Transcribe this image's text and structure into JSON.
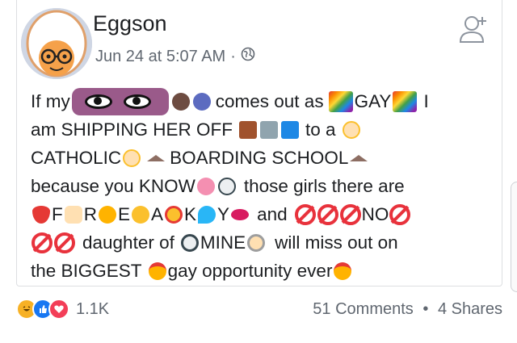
{
  "post": {
    "author": "Eggson",
    "timestamp": "Jun 24 at 5:07 AM",
    "separator": "·",
    "privacy_icon": "globe-icon",
    "lines": [
      {
        "t1": "If my",
        "t2": "comes out as",
        "t3": "GAY",
        "t4": "I"
      },
      {
        "t1": "am SHIPPING HER OFF",
        "t2": "to a"
      },
      {
        "t1": "CATHOLIC",
        "t2": "BOARDING SCHOOL"
      },
      {
        "t1": "because you KNOW",
        "t2": "those girls there are"
      },
      {
        "t1": "F",
        "t2": "R",
        "t3": "E",
        "t4": "A",
        "t5": "K",
        "t6": "Y",
        "t7": "and",
        "t8": "NO"
      },
      {
        "t1": "daughter of",
        "t2": "MINE",
        "t3": "will miss out on"
      },
      {
        "t1": "the BIGGEST",
        "t2": "gay opportunity ever"
      }
    ]
  },
  "footer": {
    "reaction_count": "1.1K",
    "comments": "51 Comments",
    "separator": "•",
    "shares": "4 Shares"
  },
  "colors": {
    "like_blue": "#1877f2",
    "love_red": "#f33e58",
    "haha_yellow": "#f7b125",
    "block_red": "#e8323c",
    "meta_gray": "#606770"
  }
}
